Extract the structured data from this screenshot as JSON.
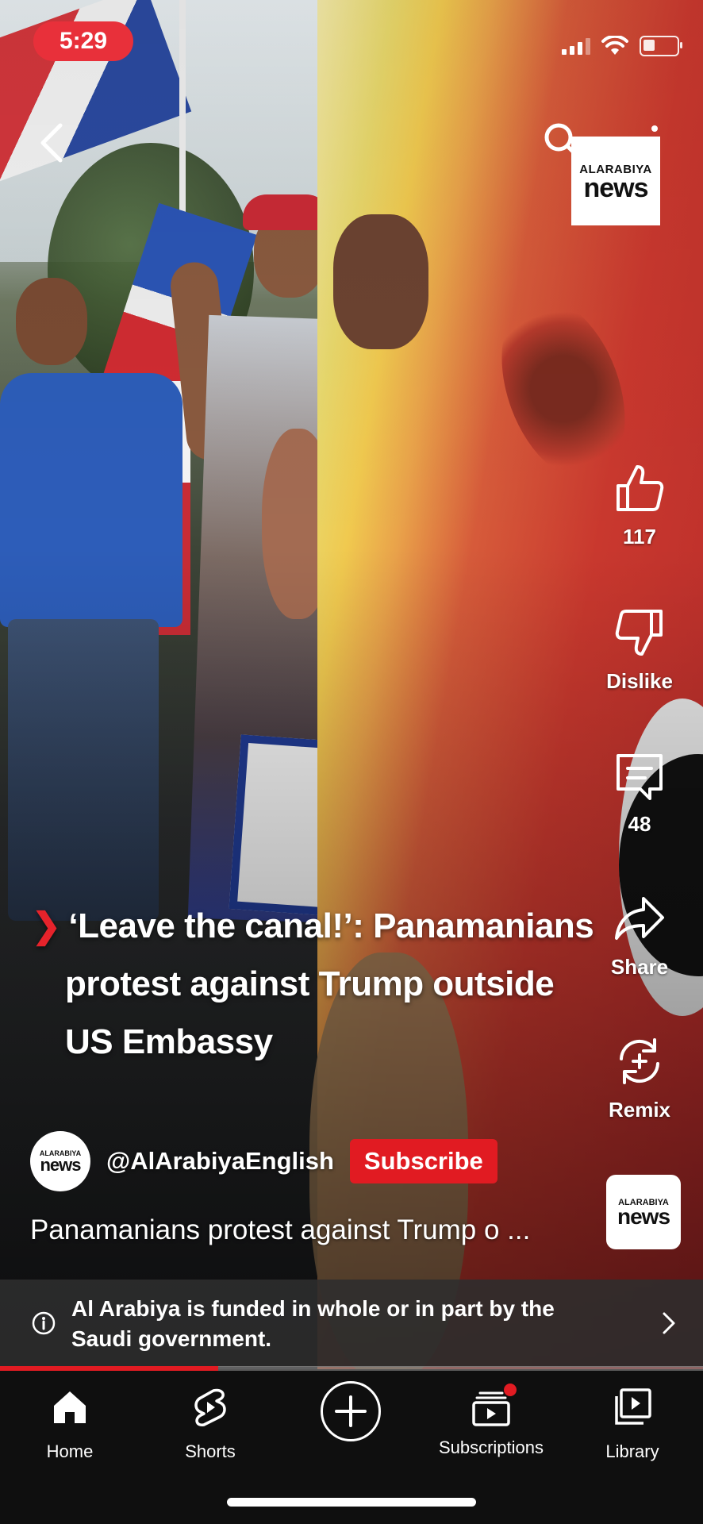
{
  "status_bar": {
    "time": "5:29"
  },
  "channel_logo": {
    "small": "ALARABIYA",
    "big": "news"
  },
  "actions": {
    "like_count": "117",
    "dislike_label": "Dislike",
    "comment_count": "48",
    "share_label": "Share",
    "remix_label": "Remix"
  },
  "caption": {
    "line1": "‘Leave the canal!’: Panamanians",
    "line2": "protest against Trump outside",
    "line3": "US Embassy"
  },
  "channel": {
    "handle": "@AlArabiyaEnglish",
    "subscribe_label": "Subscribe",
    "avatar_small": "ALARABIYA",
    "avatar_big": "news"
  },
  "description": "Panamanians protest against Trump o ...",
  "sound_thumb": {
    "small": "ALARABIYA",
    "big": "news"
  },
  "info_panel": {
    "text": "Al Arabiya is funded in whole or in part by the Saudi government."
  },
  "progress": {
    "fraction": 0.31
  },
  "nav": {
    "home": "Home",
    "shorts": "Shorts",
    "subscriptions": "Subscriptions",
    "library": "Library"
  },
  "colors": {
    "accent": "#e11b22",
    "status_pill": "#e8303a",
    "nav_bg": "#0f0f0f"
  }
}
